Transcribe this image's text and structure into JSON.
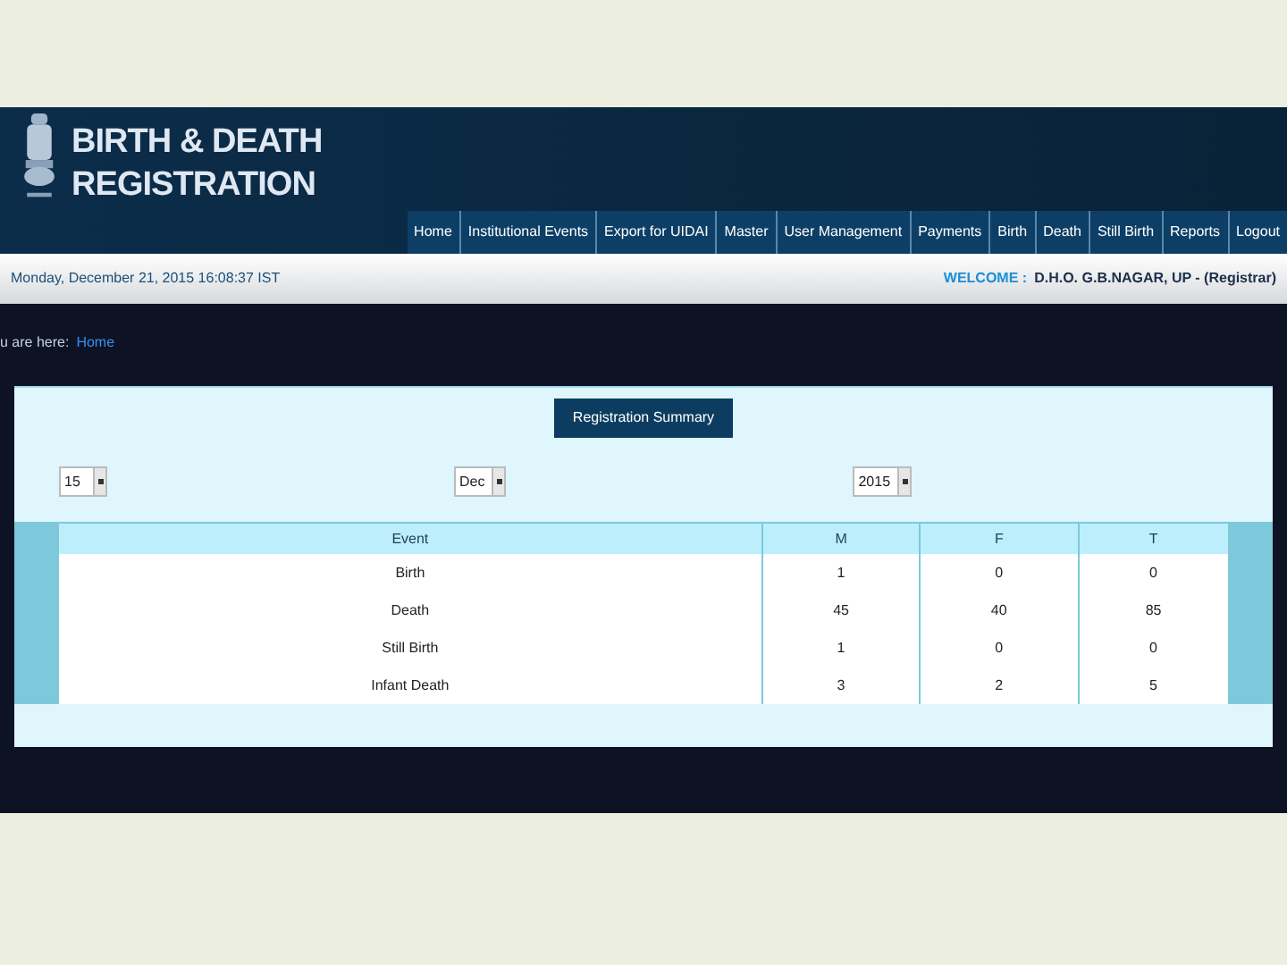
{
  "header": {
    "title_line_1": "BIRTH & DEATH",
    "title_line_2": "REGISTRATION"
  },
  "nav": [
    {
      "label": "Home"
    },
    {
      "label": "Institutional Events"
    },
    {
      "label": "Export for UIDAI"
    },
    {
      "label": "Master"
    },
    {
      "label": "User Management"
    },
    {
      "label": "Payments"
    },
    {
      "label": "Birth"
    },
    {
      "label": "Death"
    },
    {
      "label": "Still Birth"
    },
    {
      "label": "Reports"
    },
    {
      "label": "Logout"
    }
  ],
  "status_bar": {
    "datetime": "Monday, December 21, 2015 16:08:37 IST",
    "welcome_label": "WELCOME :",
    "user": "D.H.O. G.B.NAGAR, UP - (Registrar)"
  },
  "breadcrumb": {
    "prefix": "u are here:",
    "link": "Home"
  },
  "summary": {
    "button": "Registration Summary",
    "selects": [
      {
        "value": "15"
      },
      {
        "value": "Dec"
      },
      {
        "value": "2015"
      }
    ],
    "table": {
      "columns": [
        "Event",
        "M",
        "F",
        "T"
      ],
      "rows": [
        [
          "Birth",
          "1",
          "0",
          "0"
        ],
        [
          "Death",
          "45",
          "40",
          "85"
        ],
        [
          "Still Birth",
          "1",
          "0",
          "0"
        ],
        [
          "Infant Death",
          "3",
          "2",
          "5"
        ]
      ]
    }
  }
}
